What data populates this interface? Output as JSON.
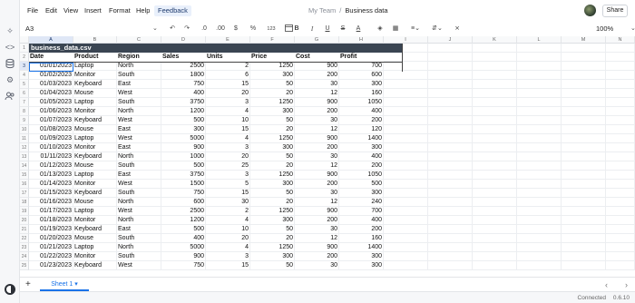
{
  "menu": [
    "File",
    "Edit",
    "View",
    "Insert",
    "Format",
    "Help"
  ],
  "feedback_label": "Feedback",
  "breadcrumb": {
    "team": "My Team",
    "separator": "/",
    "doc": "Business data"
  },
  "share_label": "Share",
  "toolbar": {
    "cell_ref": "A3",
    "decrease_decimals": ".0",
    "increase_decimals": ".00",
    "currency": "$",
    "percent": "%",
    "number_format": "123",
    "zoom": "100%"
  },
  "columns": [
    "A",
    "B",
    "C",
    "D",
    "E",
    "F",
    "G",
    "H",
    "I",
    "J",
    "K",
    "L",
    "M",
    "N"
  ],
  "selected_column": "A",
  "selected_row": 3,
  "sheet": {
    "title": "business_data.csv",
    "headers": [
      "Date",
      "Product",
      "Region",
      "Sales",
      "Units",
      "Price",
      "Cost",
      "Profit"
    ],
    "rows": [
      [
        "01/01/2023",
        "Laptop",
        "North",
        "2500",
        "2",
        "1250",
        "900",
        "700"
      ],
      [
        "01/02/2023",
        "Monitor",
        "South",
        "1800",
        "6",
        "300",
        "200",
        "600"
      ],
      [
        "01/03/2023",
        "Keyboard",
        "East",
        "750",
        "15",
        "50",
        "30",
        "300"
      ],
      [
        "01/04/2023",
        "Mouse",
        "West",
        "400",
        "20",
        "20",
        "12",
        "160"
      ],
      [
        "01/05/2023",
        "Laptop",
        "South",
        "3750",
        "3",
        "1250",
        "900",
        "1050"
      ],
      [
        "01/06/2023",
        "Monitor",
        "North",
        "1200",
        "4",
        "300",
        "200",
        "400"
      ],
      [
        "01/07/2023",
        "Keyboard",
        "West",
        "500",
        "10",
        "50",
        "30",
        "200"
      ],
      [
        "01/08/2023",
        "Mouse",
        "East",
        "300",
        "15",
        "20",
        "12",
        "120"
      ],
      [
        "01/09/2023",
        "Laptop",
        "West",
        "5000",
        "4",
        "1250",
        "900",
        "1400"
      ],
      [
        "01/10/2023",
        "Monitor",
        "East",
        "900",
        "3",
        "300",
        "200",
        "300"
      ],
      [
        "01/11/2023",
        "Keyboard",
        "North",
        "1000",
        "20",
        "50",
        "30",
        "400"
      ],
      [
        "01/12/2023",
        "Mouse",
        "South",
        "500",
        "25",
        "20",
        "12",
        "200"
      ],
      [
        "01/13/2023",
        "Laptop",
        "East",
        "3750",
        "3",
        "1250",
        "900",
        "1050"
      ],
      [
        "01/14/2023",
        "Monitor",
        "West",
        "1500",
        "5",
        "300",
        "200",
        "500"
      ],
      [
        "01/15/2023",
        "Keyboard",
        "South",
        "750",
        "15",
        "50",
        "30",
        "300"
      ],
      [
        "01/16/2023",
        "Mouse",
        "North",
        "600",
        "30",
        "20",
        "12",
        "240"
      ],
      [
        "01/17/2023",
        "Laptop",
        "West",
        "2500",
        "2",
        "1250",
        "900",
        "700"
      ],
      [
        "01/18/2023",
        "Monitor",
        "North",
        "1200",
        "4",
        "300",
        "200",
        "400"
      ],
      [
        "01/19/2023",
        "Keyboard",
        "East",
        "500",
        "10",
        "50",
        "30",
        "200"
      ],
      [
        "01/20/2023",
        "Mouse",
        "South",
        "400",
        "20",
        "20",
        "12",
        "160"
      ],
      [
        "01/21/2023",
        "Laptop",
        "North",
        "5000",
        "4",
        "1250",
        "900",
        "1400"
      ],
      [
        "01/22/2023",
        "Monitor",
        "South",
        "900",
        "3",
        "300",
        "200",
        "300"
      ],
      [
        "01/23/2023",
        "Keyboard",
        "West",
        "750",
        "15",
        "50",
        "30",
        "300"
      ]
    ]
  },
  "sheet_tab": "Sheet 1",
  "status": "Connected",
  "version": "0.6.10",
  "icons": {
    "rail": [
      "sparkle-icon",
      "code-icon",
      "database-icon",
      "settings-icon",
      "users-icon"
    ],
    "toolbar": [
      "undo-icon",
      "redo-icon",
      "calendar-icon",
      "bold-icon",
      "italic-icon",
      "underline-icon",
      "strikethrough-icon",
      "text-color-icon",
      "fill-color-icon",
      "borders-icon",
      "align-icon",
      "vertical-align-icon",
      "clear-format-icon"
    ]
  }
}
